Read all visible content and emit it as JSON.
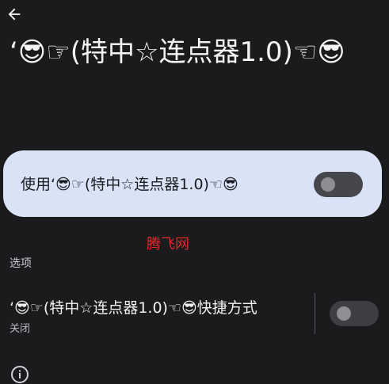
{
  "app": {
    "title": "‘😎☞(特中☆连点器1.0)☜😎"
  },
  "main_toggle": {
    "label": "使用‘😎☞(特中☆连点器1.0)☜😎",
    "state": "off"
  },
  "watermark": "腾飞网",
  "options": {
    "header": "选项",
    "shortcut": {
      "title": "‘😎☞(特中☆连点器1.0)☜😎快捷方式",
      "subtitle": "关闭",
      "state": "off"
    }
  },
  "icons": {
    "back": "arrow-back-icon",
    "info": "info-icon"
  },
  "colors": {
    "background": "#1b1b1d",
    "card": "#d9e3f5",
    "watermark": "#e12a2a"
  }
}
